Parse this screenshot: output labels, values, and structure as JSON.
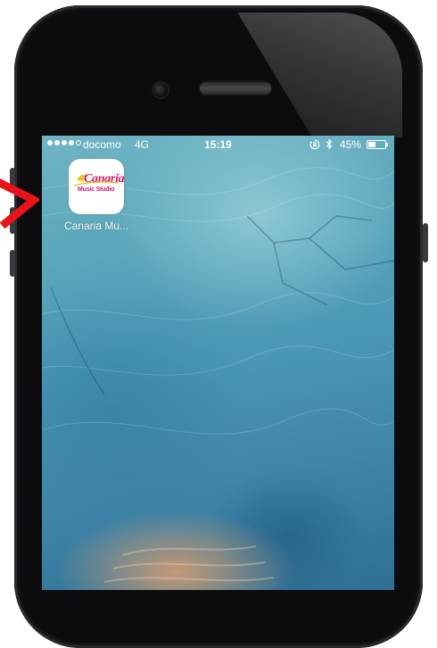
{
  "status_bar": {
    "carrier": "docomo",
    "network": "4G",
    "time": "15:19",
    "battery_percent_label": "45%",
    "battery_level": 0.45,
    "signal_bars_filled": 4,
    "signal_bars_total": 5,
    "icons": [
      "signal-dots-icon",
      "rotation-lock-icon",
      "bluetooth-icon",
      "battery-icon"
    ]
  },
  "home_screen": {
    "apps": [
      {
        "label": "Canaria Mu...",
        "icon_name": "canaria-music-studio-app-icon",
        "logo_text": "Canaria",
        "logo_subtext": "Music Studio"
      }
    ]
  },
  "annotation": {
    "icon_name": "red-arrow-pointer-icon",
    "color": "#e8141c"
  },
  "colors": {
    "logo_pink": "#d4146b",
    "logo_yellow": "#f2c21b",
    "arrow_red": "#e8141c"
  }
}
